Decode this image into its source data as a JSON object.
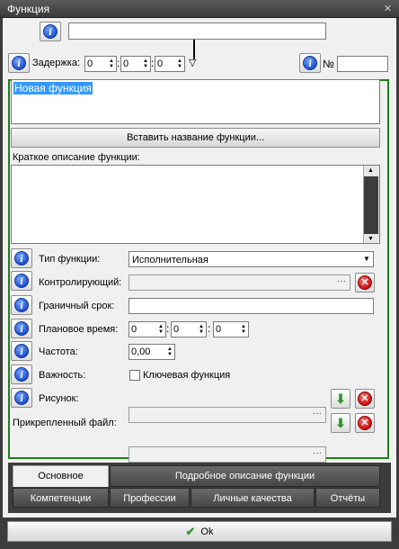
{
  "window": {
    "title": "Функция",
    "close_glyph": "✕"
  },
  "top": {
    "name_value": "",
    "delay_label": "Задержка:",
    "delay_hours": "0",
    "delay_minutes": "0",
    "delay_seconds": "0",
    "time_sep": ":",
    "number_label": "№",
    "number_value": ""
  },
  "form": {
    "name_text": "Новая функция",
    "insert_name_button": "Вставить название функции...",
    "short_desc_label": "Краткое описание функции:",
    "short_desc_value": "",
    "type_label": "Тип функции:",
    "type_value": "Исполнительная",
    "controller_label": "Контролирующий:",
    "controller_value": "",
    "deadline_label": "Граничный срок:",
    "deadline_value": "",
    "planned_time_label": "Плановое время:",
    "planned_h": "0",
    "planned_m": "0",
    "planned_s": "0",
    "frequency_label": "Частота:",
    "frequency_value": "0,00",
    "importance_label": "Важность:",
    "key_function_label": "Ключевая функция",
    "picture_label": "Рисунок:",
    "picture_value": "",
    "attached_file_label": "Прикрепленный файл:",
    "attached_file_value": "",
    "browse_glyph": "···"
  },
  "tabs_row1": [
    {
      "label": "Основное",
      "active": true
    },
    {
      "label": "Подробное описание функции",
      "active": false
    }
  ],
  "tabs_row2": [
    {
      "label": "Компетенции"
    },
    {
      "label": "Профессии"
    },
    {
      "label": "Личные качества"
    },
    {
      "label": "Отчёты"
    }
  ],
  "footer": {
    "ok_label": "Ok"
  },
  "icons": {
    "info": "info-icon",
    "delete": "delete-icon",
    "download": "download-arrow-icon",
    "check": "checkmark-icon",
    "accent_green": "#1e7d1e"
  }
}
